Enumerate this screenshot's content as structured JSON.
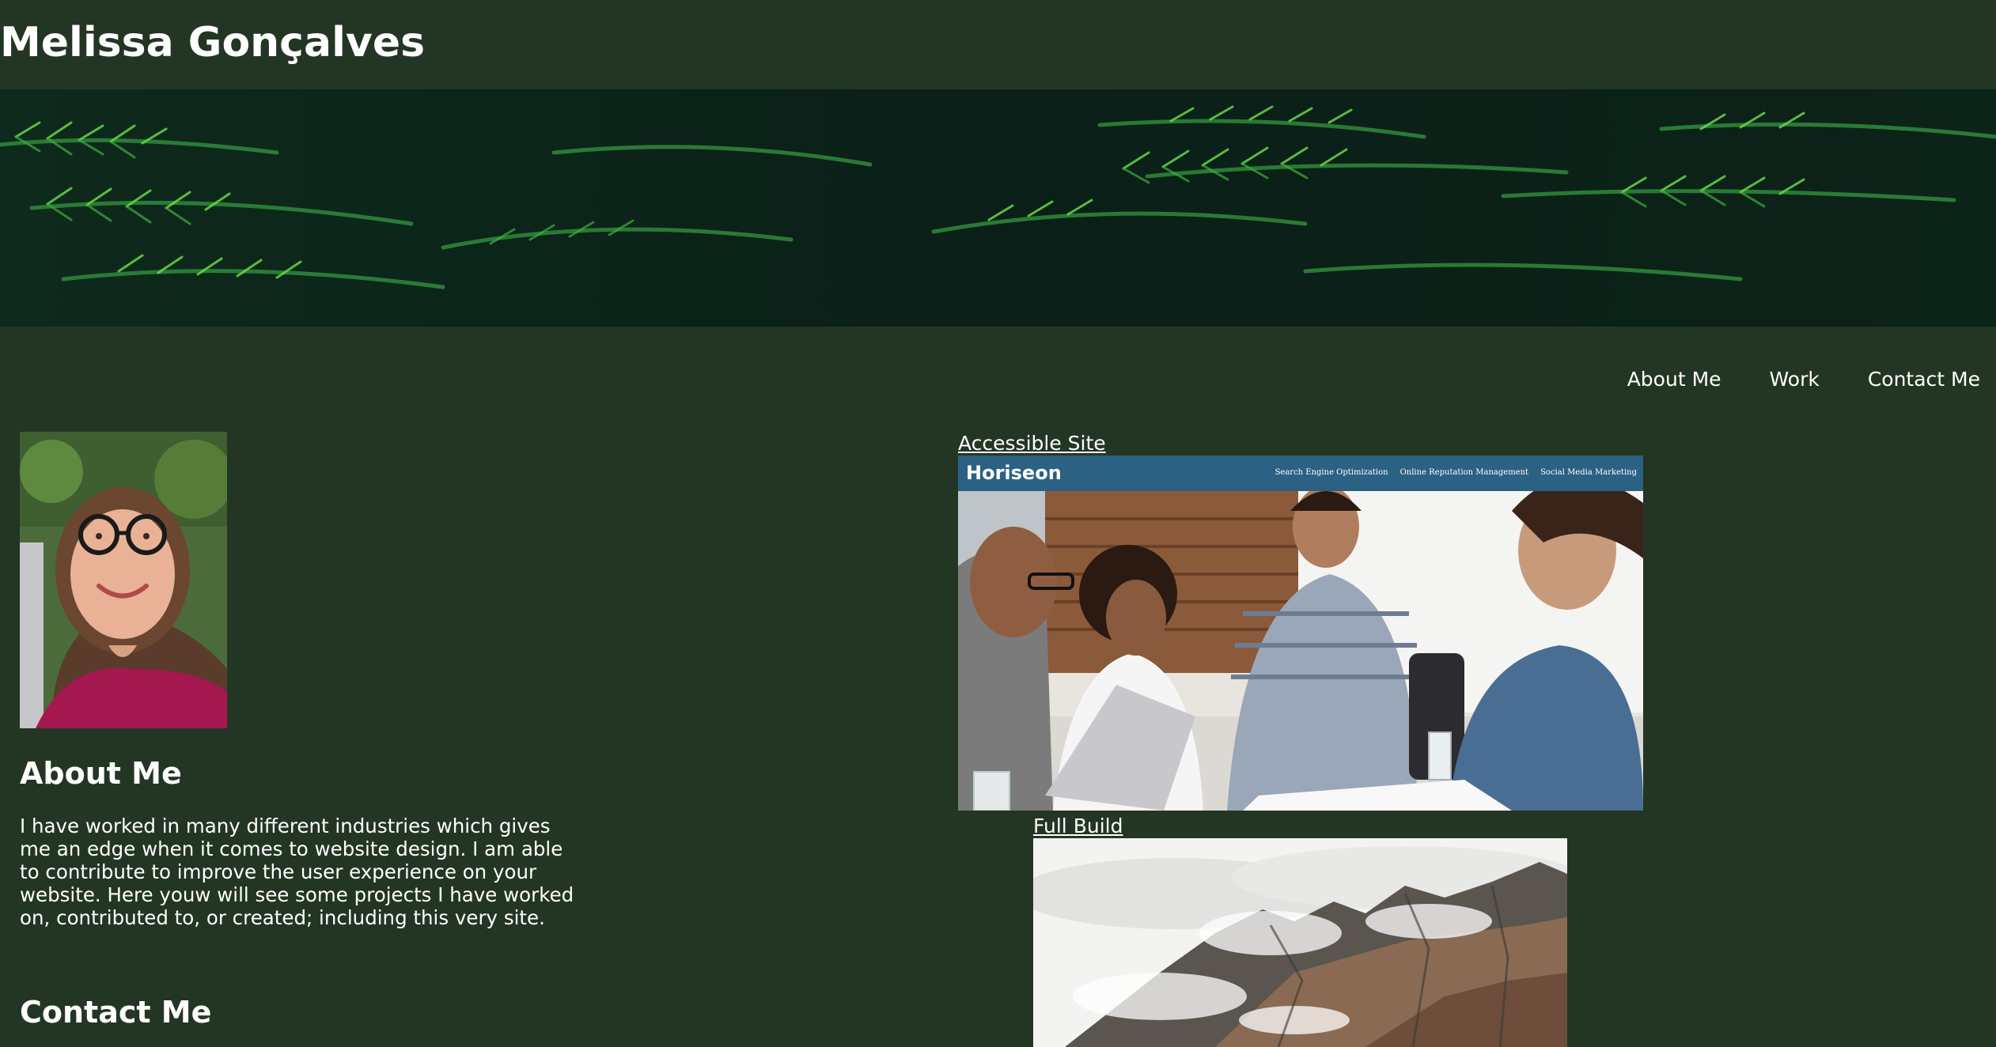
{
  "header": {
    "site_name": "Melissa Gonçalves"
  },
  "hero": {
    "subject": "evergreen branches banner"
  },
  "nav": {
    "items": [
      {
        "label": "About Me"
      },
      {
        "label": "Work"
      },
      {
        "label": "Contact Me"
      }
    ]
  },
  "about": {
    "heading": "About Me",
    "text": "I have worked in many different industries which gives me an edge when it comes to website design. I am able to contribute to improve the user experience on your website. Here youw will see some projects I have worked on, contributed to, or created; including this very site."
  },
  "contact": {
    "heading": "Contact Me"
  },
  "work": {
    "projects": [
      {
        "link_label": "Accessible Site",
        "preview": {
          "logo": "Horiseon",
          "nav": [
            "Search Engine Optimization",
            "Online Reputation Management",
            "Social Media Marketing"
          ]
        }
      },
      {
        "link_label": "Full Build"
      }
    ]
  },
  "colors": {
    "page_background": "#233623",
    "text": "#ffffff",
    "horiseon_header": "#2b6183"
  }
}
